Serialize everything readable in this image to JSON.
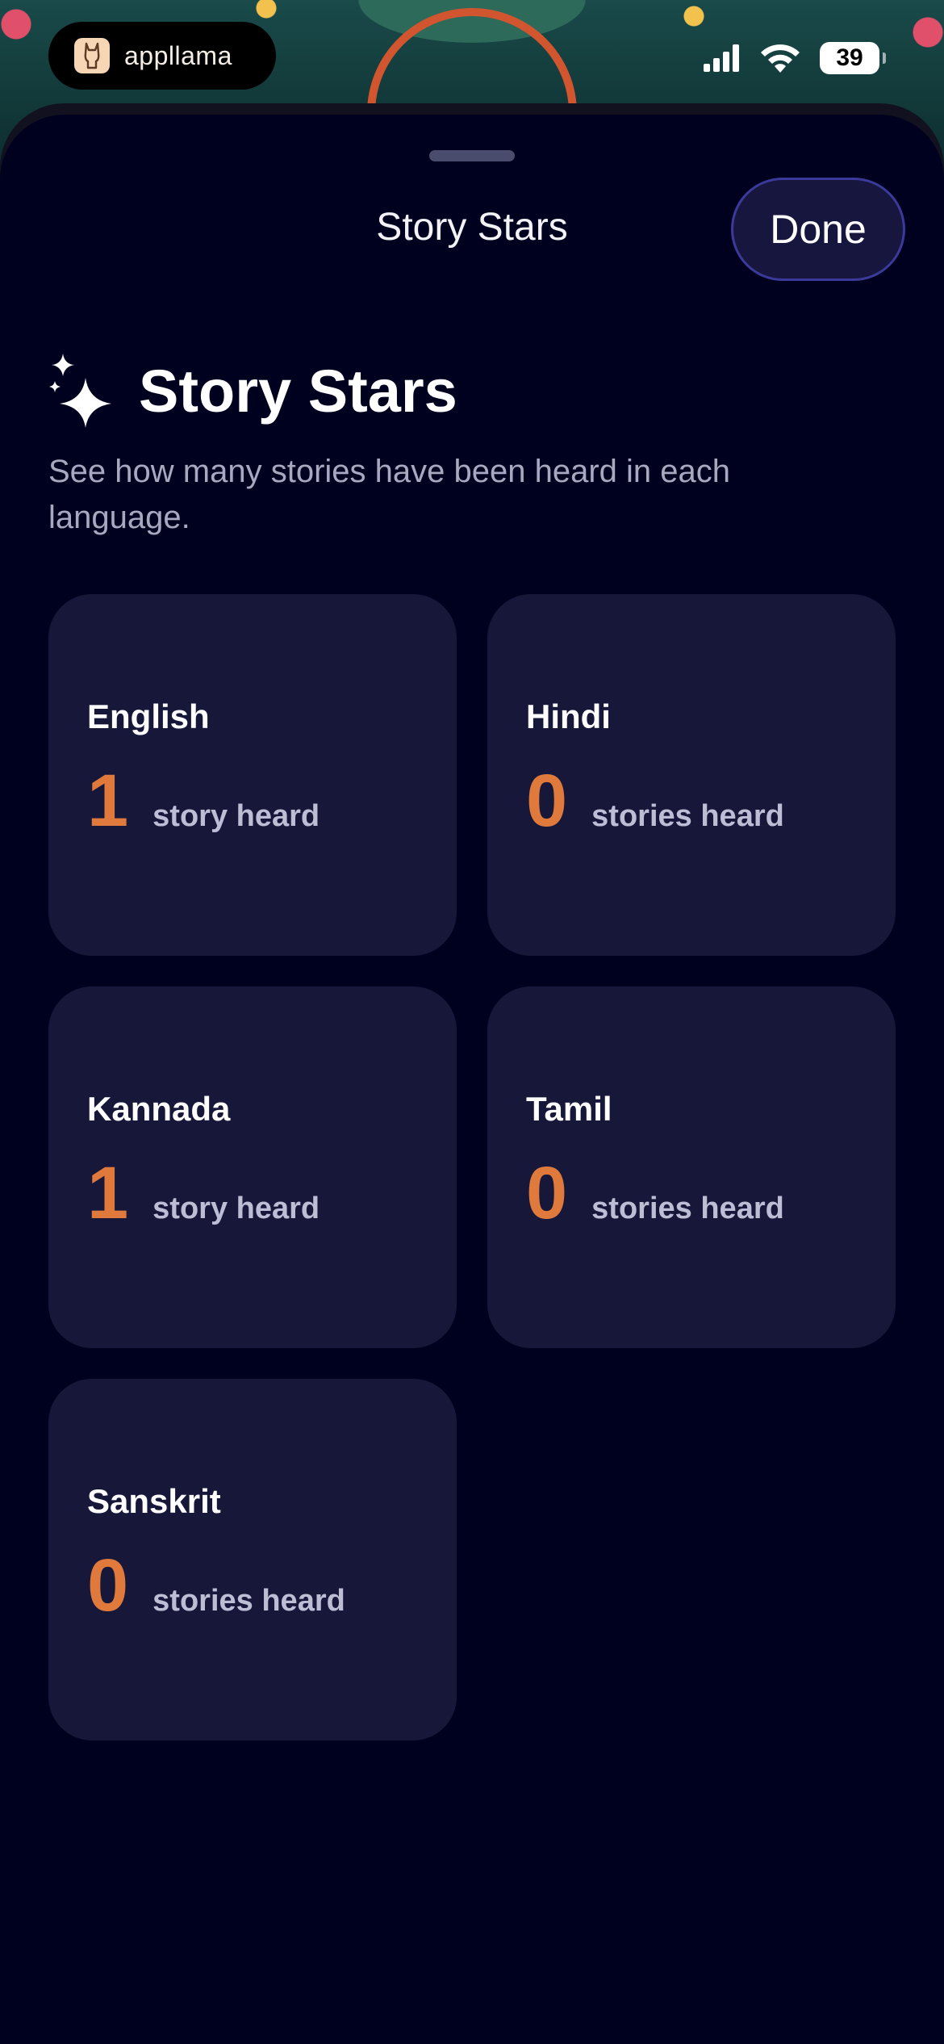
{
  "statusbar": {
    "brand_name": "appllama",
    "battery_level": "39"
  },
  "sheet": {
    "nav_title": "Story Stars",
    "done_label": "Done",
    "heading_title": "Story Stars",
    "subtitle": "See how many stories have been heard in each language."
  },
  "languages": [
    {
      "name": "English",
      "count": "1",
      "unit": "story heard"
    },
    {
      "name": "Hindi",
      "count": "0",
      "unit": "stories heard"
    },
    {
      "name": "Kannada",
      "count": "1",
      "unit": "story heard"
    },
    {
      "name": "Tamil",
      "count": "0",
      "unit": "stories heard"
    },
    {
      "name": "Sanskrit",
      "count": "0",
      "unit": "stories heard"
    }
  ],
  "colors": {
    "background": "#00011f",
    "card": "#17173a",
    "count_accent": "#e07a3c",
    "done_border": "#3b3a9a"
  },
  "icons": {
    "heading": "sparkles-icon",
    "signal": "cellular-signal-icon",
    "wifi": "wifi-icon",
    "battery": "battery-icon",
    "brand": "llama-logo-icon"
  }
}
